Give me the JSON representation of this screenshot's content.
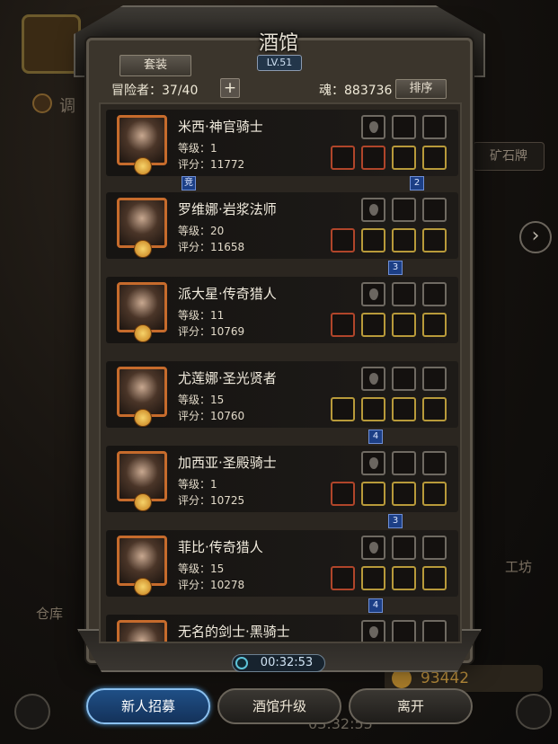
{
  "screen": {
    "title": "酒馆",
    "level_badge": "LV.51",
    "set_button": "套装",
    "adventurers_label": "冒险者：37/40",
    "add_button": "+",
    "soul_label": "魂：883736",
    "sort_button": "排序",
    "timer": "00:32:53"
  },
  "background": {
    "left_label": "调",
    "mine_label": "矿石牌",
    "workshop_label": "工坊",
    "warehouse_label": "仓库",
    "gold_value": "93442",
    "timer_faded": "03:32:55",
    "right_arrow": "›",
    "number_fragment": "3"
  },
  "heroes": [
    {
      "name": "米西·神官骑士",
      "level": "等级：1",
      "score": "评分：11772"
    },
    {
      "name": "罗维娜·岩浆法师",
      "level": "等级：20",
      "score": "评分：11658"
    },
    {
      "name": "派大星·传奇猎人",
      "level": "等级：11",
      "score": "评分：10769"
    },
    {
      "name": "尤莲娜·圣光贤者",
      "level": "等级：15",
      "score": "评分：10760"
    },
    {
      "name": "加西亚·圣殿骑士",
      "level": "等级：1",
      "score": "评分：10725"
    },
    {
      "name": "菲比·传奇猎人",
      "level": "等级：15",
      "score": "评分：10278"
    },
    {
      "name": "无名的剑士·黑骑士",
      "level": "",
      "score": ""
    }
  ],
  "tags": [
    "竞",
    "2",
    "3",
    "4",
    "3",
    "4"
  ],
  "buttons": {
    "recruit": "新人招募",
    "upgrade": "酒馆升级",
    "leave": "离开"
  },
  "colors": {
    "recruit_accent": "#1f4f86",
    "portrait_border": "#c66b2c",
    "tag_blue": "#1c3f86"
  }
}
